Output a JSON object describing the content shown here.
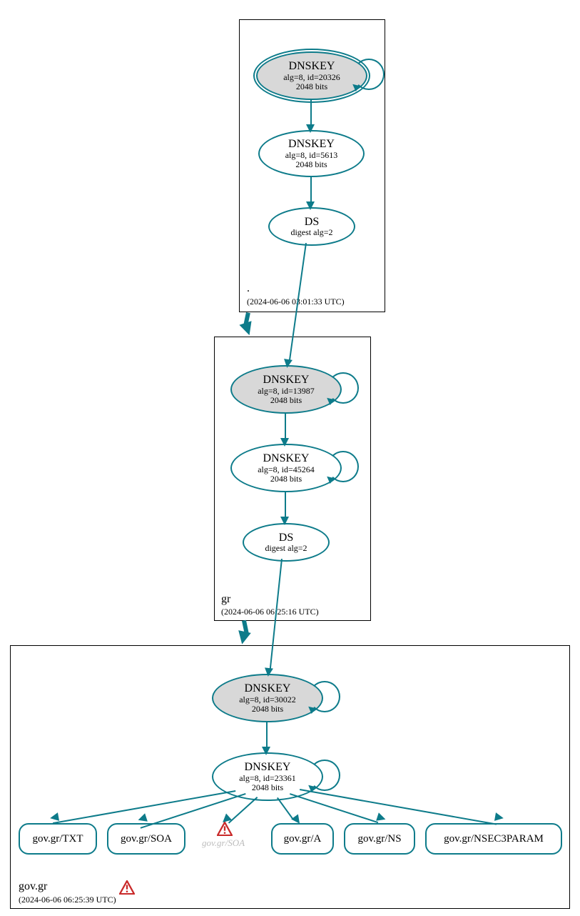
{
  "colors": {
    "stroke": "#0d7b8a",
    "fill_grey": "#d8d8d8",
    "warn": "#c92a2a"
  },
  "zones": {
    "root": {
      "label": ".",
      "timestamp": "(2024-06-06 03:01:33 UTC)",
      "nodes": {
        "ksk": {
          "title": "DNSKEY",
          "sub1": "alg=8, id=20326",
          "sub2": "2048 bits"
        },
        "zsk": {
          "title": "DNSKEY",
          "sub1": "alg=8, id=5613",
          "sub2": "2048 bits"
        },
        "ds": {
          "title": "DS",
          "sub1": "digest alg=2"
        }
      }
    },
    "gr": {
      "label": "gr",
      "timestamp": "(2024-06-06 06:25:16 UTC)",
      "nodes": {
        "ksk": {
          "title": "DNSKEY",
          "sub1": "alg=8, id=13987",
          "sub2": "2048 bits"
        },
        "zsk": {
          "title": "DNSKEY",
          "sub1": "alg=8, id=45264",
          "sub2": "2048 bits"
        },
        "ds": {
          "title": "DS",
          "sub1": "digest alg=2"
        }
      }
    },
    "govgr": {
      "label": "gov.gr",
      "timestamp": "(2024-06-06 06:25:39 UTC)",
      "nodes": {
        "ksk": {
          "title": "DNSKEY",
          "sub1": "alg=8, id=30022",
          "sub2": "2048 bits"
        },
        "zsk": {
          "title": "DNSKEY",
          "sub1": "alg=8, id=23361",
          "sub2": "2048 bits"
        }
      },
      "rrsets": {
        "txt": "gov.gr/TXT",
        "soa": "gov.gr/SOA",
        "soa_faint": "gov.gr/SOA",
        "a": "gov.gr/A",
        "ns": "gov.gr/NS",
        "nsec3": "gov.gr/NSEC3PARAM"
      }
    }
  }
}
